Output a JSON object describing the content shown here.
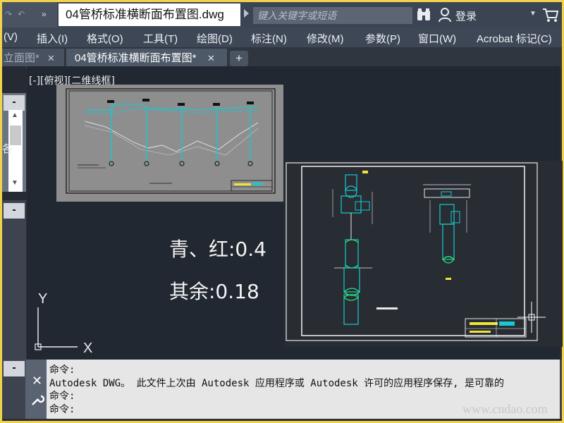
{
  "quick_access": {
    "glyphs": "»"
  },
  "title_bar": {
    "document_title": "04管桥标准横断面布置图.dwg",
    "search_placeholder": "键入关键字或短语",
    "login_label": "登录"
  },
  "menu": {
    "items": [
      "(V)",
      "插入(I)",
      "格式(O)",
      "工具(T)",
      "绘图(D)",
      "标注(N)",
      "修改(M)",
      "参数(P)",
      "窗口(W)",
      "Acrobat 标记(C)"
    ]
  },
  "tabs": {
    "items": [
      {
        "label": "立面图*",
        "active": false
      },
      {
        "label": "04管桥标准横断面布置图*",
        "active": true
      }
    ],
    "close_glyph": "✕",
    "add_glyph": "+"
  },
  "palette": {
    "minus_glyph": "-",
    "visible_letter": "各"
  },
  "viewport": {
    "label": "[-][俯视][二维线框]"
  },
  "drawing_notes": {
    "line1": "青、红:0.4",
    "line2": "其余:0.18"
  },
  "ucs": {
    "x_label": "X",
    "y_label": "Y"
  },
  "command": {
    "lines": [
      "命令:",
      "Autodesk DWG。  此文件上次由 Autodesk 应用程序或 Autodesk 许可的应用程序保存, 是可靠的",
      "命令:",
      "命令:"
    ],
    "close_glyph": "✕"
  },
  "watermark": "www.cndao.com",
  "colors": {
    "accent_frame": "#f2d24a",
    "canvas_bg": "#222831",
    "cyan_lines": "#19c8d0",
    "green_lines": "#2ee66a",
    "yellow_lines": "#f0e43a"
  }
}
